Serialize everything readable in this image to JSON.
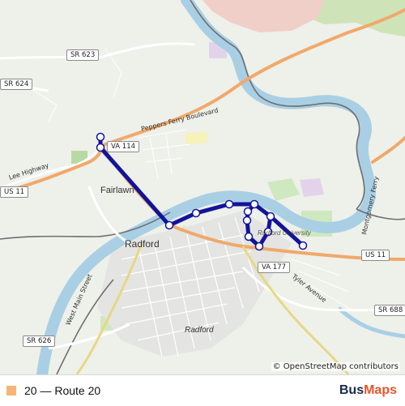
{
  "map": {
    "route_color": "#13139a",
    "river_color": "#a9cfe4",
    "roads": {
      "sr623": "SR 623",
      "sr624": "SR 624",
      "va114": "VA 114",
      "peppers": "Peppers Ferry Boulevard",
      "lee": "Lee Highway",
      "us11_left": "US 11",
      "us11_right": "US 11",
      "va177": "VA 177",
      "tyler": "Tyler Avenue",
      "sr688": "SR 688",
      "west_main": "West Main Street",
      "sr626": "SR 626",
      "montgomery": "Montgomery Ferry"
    },
    "places": {
      "fairlawn": "Fairlawn",
      "radford": "Radford",
      "radford_district": "Radford",
      "university": "Radford University"
    },
    "attribution": "© OpenStreetMap contributors"
  },
  "legend": {
    "swatch_color": "#f6b477",
    "label": "20 — Route 20"
  },
  "brand": {
    "part1": "Bus",
    "part2": "Maps"
  }
}
